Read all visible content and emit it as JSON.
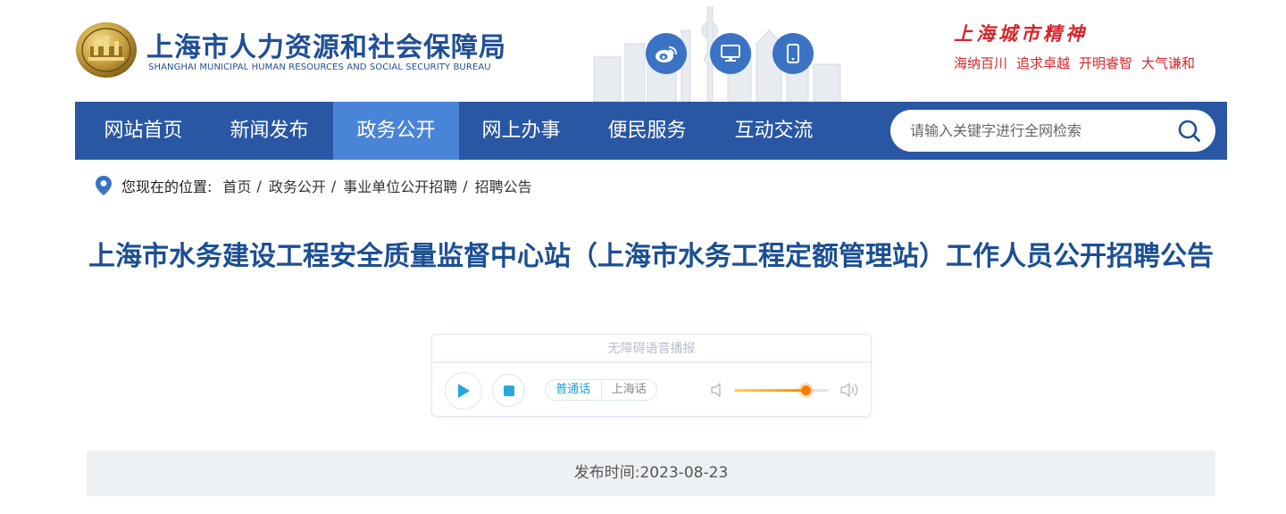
{
  "header": {
    "org_name_cn": "上海市人力资源和社会保障局",
    "org_name_en": "SHANGHAI MUNICIPAL HUMAN RESOURCES AND SOCIAL SECURITY BUREAU",
    "social_icons": [
      "weibo-icon",
      "desktop-icon",
      "mobile-icon"
    ],
    "social_bg_color": "#3b73c4",
    "spirit": {
      "title": "上海城市精神",
      "items": [
        "海纳百川",
        "追求卓越",
        "开明睿智",
        "大气谦和"
      ],
      "color": "#d6262a"
    }
  },
  "nav": {
    "items": [
      {
        "label": "网站首页",
        "active": false
      },
      {
        "label": "新闻发布",
        "active": false
      },
      {
        "label": "政务公开",
        "active": true
      },
      {
        "label": "网上办事",
        "active": false
      },
      {
        "label": "便民服务",
        "active": false
      },
      {
        "label": "互动交流",
        "active": false
      }
    ],
    "bg_color": "#2957a4",
    "active_color": "#4a84d6",
    "search": {
      "placeholder": "请输入关键字进行全网检索",
      "value": "",
      "icon": "search-icon"
    }
  },
  "breadcrumb": {
    "label": "您现在的位置:",
    "items": [
      "首页",
      "政务公开",
      "事业单位公开招聘",
      "招聘公告"
    ],
    "separator": "/"
  },
  "article": {
    "title": "上海市水务建设工程安全质量监督中心站（上海市水务工程定额管理站）工作人员公开招聘公告",
    "title_color": "#1b4f94"
  },
  "voice_player": {
    "header": "无障碍语音播报",
    "controls": [
      "play-icon",
      "stop-icon"
    ],
    "dialects": [
      {
        "label": "普通话",
        "active": true
      },
      {
        "label": "上海话",
        "active": false
      }
    ],
    "volume_fraction": 0.75
  },
  "publish": {
    "label": "发布时间:",
    "date": "2023-08-23"
  }
}
